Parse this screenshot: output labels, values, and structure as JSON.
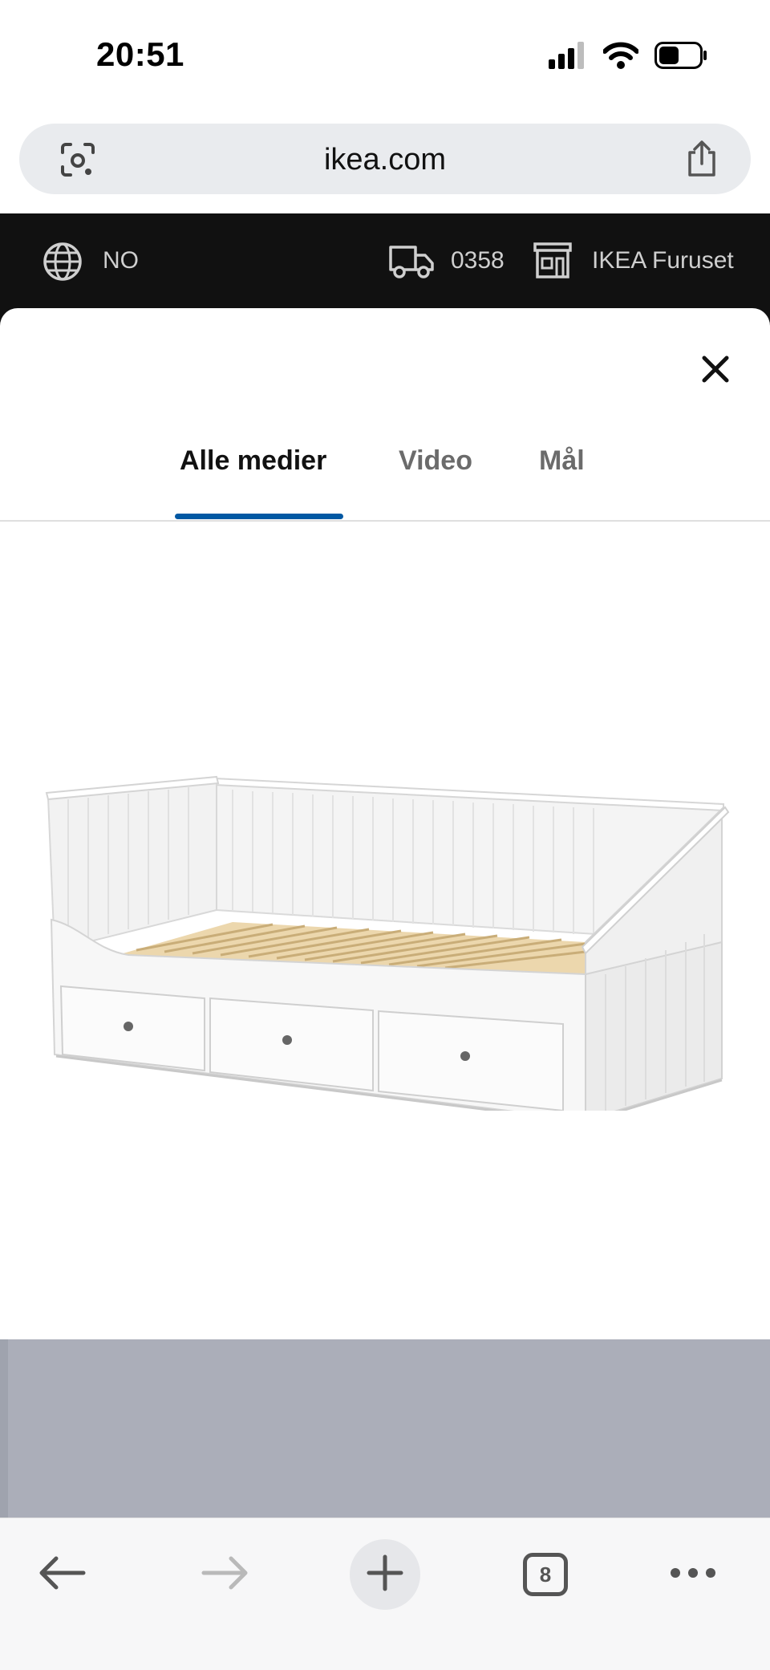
{
  "status_bar": {
    "time": "20:51",
    "icons": [
      "cellular-signal-icon",
      "wifi-icon",
      "battery-icon"
    ]
  },
  "browser": {
    "url": "ikea.com",
    "left_icon": "lens-scan-icon",
    "right_icon": "share-icon"
  },
  "site_header": {
    "country": "NO",
    "postal_code": "0358",
    "store": "IKEA Furuset",
    "icons": [
      "globe-icon",
      "truck-icon",
      "store-icon"
    ]
  },
  "media_viewer": {
    "tabs": [
      {
        "label": "Alle medier",
        "active": true
      },
      {
        "label": "Video",
        "active": false
      },
      {
        "label": "Mål",
        "active": false
      }
    ],
    "close_icon": "close-icon",
    "image": "daybed-with-three-drawers"
  },
  "bottom_toolbar": {
    "tab_count": "8",
    "icons": [
      "back-arrow-icon",
      "forward-arrow-icon",
      "plus-icon",
      "tabs-icon",
      "more-icon"
    ]
  },
  "colors": {
    "header_bg": "#111111",
    "tab_underline": "#0058a3",
    "gray_band": "#abaeb9"
  }
}
